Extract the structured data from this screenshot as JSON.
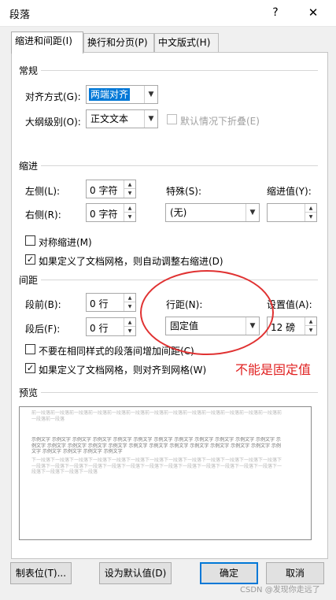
{
  "window": {
    "title": "段落",
    "help_icon": "?",
    "close_icon": "✕"
  },
  "tabs": [
    "缩进和间距(I)",
    "换行和分页(P)",
    "中文版式(H)"
  ],
  "general": {
    "section": "常规",
    "alignment_label": "对齐方式(G):",
    "alignment_value": "两端对齐",
    "outline_label": "大纲级别(O):",
    "outline_value": "正文文本",
    "collapse_label": "默认情况下折叠(E)"
  },
  "indent": {
    "section": "缩进",
    "left_label": "左侧(L):",
    "left_value": "0 字符",
    "right_label": "右侧(R):",
    "right_value": "0 字符",
    "special_label": "特殊(S):",
    "special_value": "(无)",
    "by_label": "缩进值(Y):",
    "by_value": "",
    "mirror_label": "对称缩进(M)",
    "auto_adjust_label": "如果定义了文档网格，则自动调整右缩进(D)"
  },
  "spacing": {
    "section": "间距",
    "before_label": "段前(B):",
    "before_value": "0 行",
    "after_label": "段后(F):",
    "after_value": "0 行",
    "line_spacing_label": "行距(N):",
    "line_spacing_value": "固定值",
    "at_label": "设置值(A):",
    "at_value": "12 磅",
    "no_space_label": "不要在相同样式的段落间增加间距(C)",
    "snap_grid_label": "如果定义了文档网格，则对齐到网格(W)"
  },
  "preview": {
    "section": "预览",
    "prev_text": "前一段落前一段落前一段落前一段落前一段落前一段落前一段落前一段落前一段落前一段落前一段落前一段落前一段落前一段落前一段落",
    "sample_text": "示例文字 示例文字 示例文字 示例文字 示例文字 示例文字 示例文字 示例文字 示例文字 示例文字 示例文字 示例文字 示例文字 示例文字 示例文字 示例文字 示例文字 示例文字 示例文字 示例文字 示例文字 示例文字 示例文字 示例文字 示例文字 示例文字 示例文字 示例文字 示例文字",
    "next_text": "下一段落下一段落下一段落下一段落下一段落下一段落下一段落下一段落下一段落下一段落下一段落下一段落下一段落下一段落下一段落下一段落下一段落下一段落下一段落下一段落下一段落下一段落下一段落下一段落下一段落下一段落下一段落下一段落下一段落下一段落"
  },
  "buttons": {
    "tabs": "制表位(T)...",
    "default": "设为默认值(D)",
    "ok": "确定",
    "cancel": "取消"
  },
  "annotation": "不能是固定值",
  "watermark": "CSDN @发现你走远了"
}
